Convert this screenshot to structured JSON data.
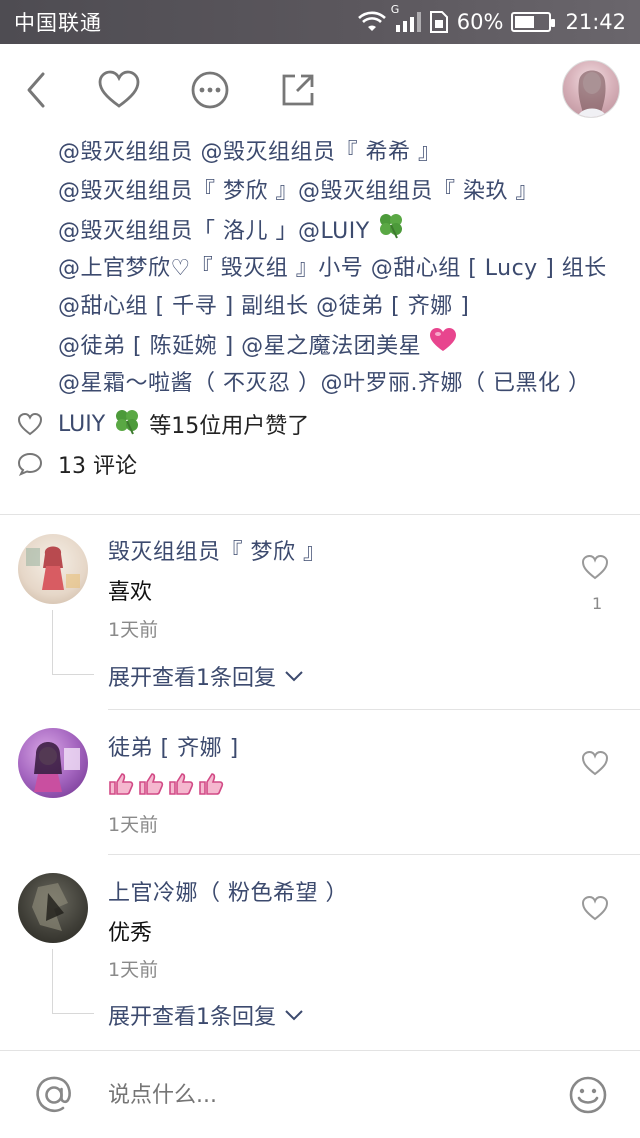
{
  "status_bar": {
    "carrier": "中国联通",
    "network_label": "G",
    "battery_percent": "60%",
    "battery_level": 0.6,
    "time": "21:42"
  },
  "toolbar": {
    "back_icon": "chevron-left-icon",
    "like_icon": "heart-outline-icon",
    "more_icon": "more-dots-icon",
    "share_icon": "share-external-icon",
    "avatar_icon": "user-avatar"
  },
  "mentions": {
    "lines": [
      "@毁灭组组员 @毁灭组组员『 希希 』",
      "@毁灭组组员『 梦欣 』@毁灭组组员『 染玖 』",
      "@毁灭组组员「 洛儿 」@LUIY",
      "@上官梦欣♡『 毁灭组 』小号 @甜心组 [ Lucy ] 组长",
      "@甜心组 [ 千寻 ] 副组长 @徒弟 [ 齐娜 ]",
      "@徒弟 [ 陈延婉 ] @星之魔法团美星",
      "@星霜～啦酱（ 不灭忍 ）@叶罗丽.齐娜（ 已黑化 ）"
    ],
    "line3_emoji": "four-leaf-clover",
    "line6_emoji": "pink-heart"
  },
  "likes": {
    "icon": "heart-outline-icon",
    "names": "LUIY",
    "emoji": "four-leaf-clover",
    "text": "等15位用户赞了"
  },
  "comments_summary": {
    "icon": "speech-bubble-icon",
    "text": "13 评论"
  },
  "comments": [
    {
      "name": "毁灭组组员『 梦欣 』",
      "text": "喜欢",
      "time": "1天前",
      "like_count": "1",
      "expand": "展开查看1条回复"
    },
    {
      "name": "徒弟 [ 齐娜 ]",
      "text": "",
      "emoji": "thumbs-up-x4",
      "time": "1天前",
      "like_count": "",
      "expand": ""
    },
    {
      "name": "上官冷娜（ 粉色希望 ）",
      "text": "优秀",
      "time": "1天前",
      "like_count": "",
      "expand": "展开查看1条回复"
    }
  ],
  "bottom_bar": {
    "at_icon": "at-sign-icon",
    "placeholder": "说点什么...",
    "emoji_icon": "smiley-face-icon"
  },
  "colors": {
    "link": "#3c4a6e",
    "status_bar": "#55525a",
    "muted": "#8a8a8a"
  }
}
